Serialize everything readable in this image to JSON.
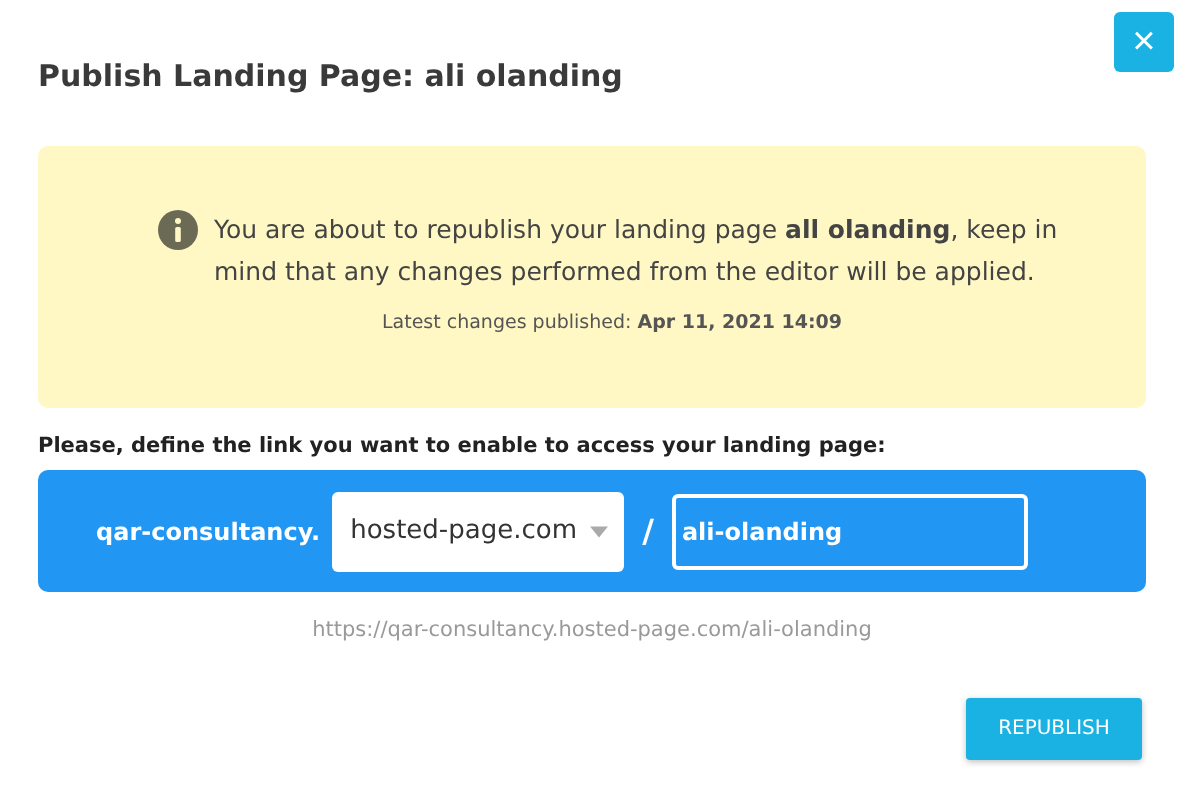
{
  "dialog": {
    "title": "Publish Landing Page: ali olanding",
    "close_icon": "×"
  },
  "notice": {
    "message": "You are about to republish your landing page **all olanding**, keep in mind that any changes performed from the editor will be applied.",
    "latest": "Latest changes published: **Apr 11, 2021 14:09**"
  },
  "link": {
    "label": "Please, define the link you want to enable to access your landing page:",
    "subdomain": "qar-consultancy.",
    "domain": "hosted-page.com",
    "separator": "/",
    "slug": "ali-olanding",
    "preview_url": "https://qar-consultancy.hosted-page.com/ali-olanding"
  },
  "buttons": [
    "REPUBLISH"
  ]
}
